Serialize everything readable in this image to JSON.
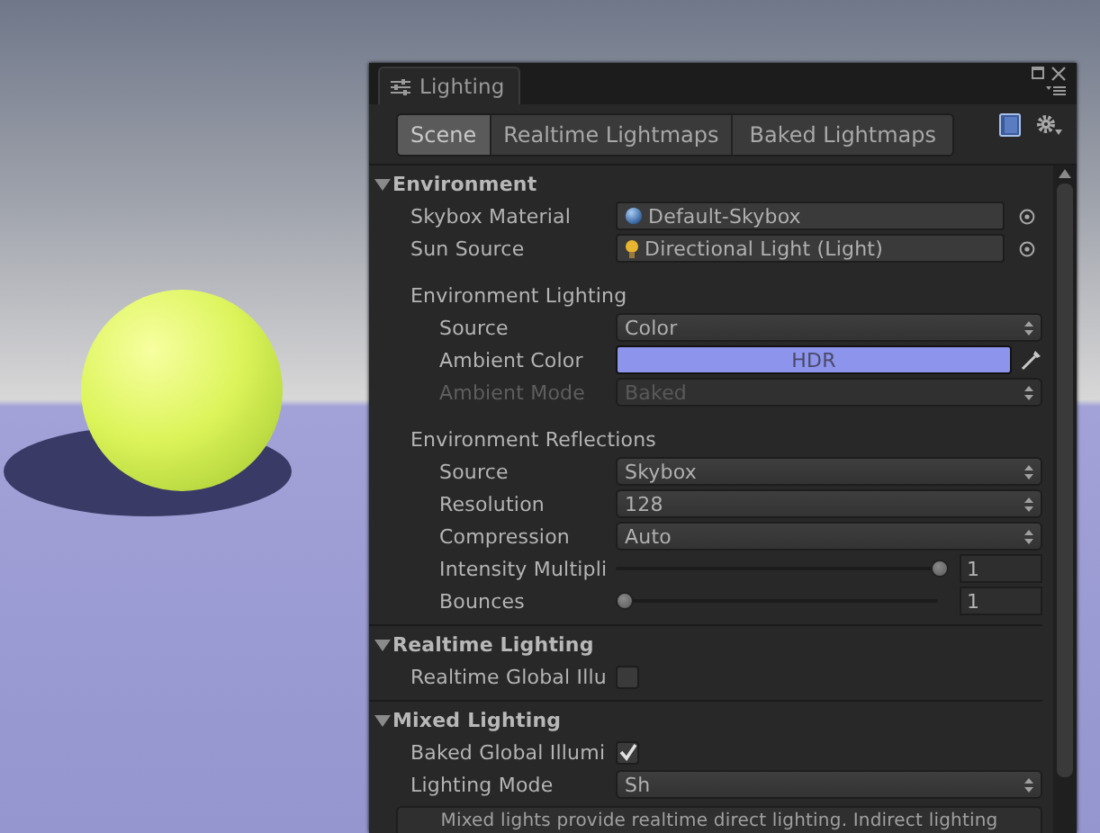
{
  "window": {
    "title": "Lighting"
  },
  "tabs": [
    {
      "label": "Scene",
      "selected": true
    },
    {
      "label": "Realtime Lightmaps",
      "selected": false
    },
    {
      "label": "Baked Lightmaps",
      "selected": false
    }
  ],
  "sections": [
    {
      "title": "Environment",
      "expanded": true,
      "rows": [
        {
          "kind": "material",
          "label": "Skybox Material",
          "value": "Default-Skybox",
          "disabled": false
        },
        {
          "kind": "light",
          "label": "Sun Source",
          "value": "Directional Light (Light)",
          "disabled": false
        },
        {
          "kind": "group",
          "title": "Environment Lighting",
          "rows": [
            {
              "kind": "dropdown",
              "label": "Source",
              "value": "Color",
              "disabled": false
            },
            {
              "kind": "color",
              "label": "Ambient Color",
              "value": "HDR",
              "color": "#8c94ec",
              "disabled": false
            },
            {
              "kind": "dropdown",
              "label": "Ambient Mode",
              "value": "Baked",
              "disabled": true
            }
          ]
        },
        {
          "kind": "group",
          "title": "Environment Reflections",
          "rows": [
            {
              "kind": "dropdown",
              "label": "Source",
              "value": "Skybox",
              "disabled": false
            },
            {
              "kind": "dropdown",
              "label": "Resolution",
              "value": "128",
              "disabled": false
            },
            {
              "kind": "dropdown",
              "label": "Compression",
              "value": "Auto",
              "disabled": false
            },
            {
              "kind": "slider",
              "label": "Intensity Multipli",
              "level": 1,
              "reading": "1",
              "disabled": false
            },
            {
              "kind": "slider",
              "label": "Bounces",
              "level": 0,
              "reading": "1",
              "disabled": false
            }
          ]
        }
      ]
    },
    {
      "title": "Realtime Lighting",
      "expanded": true,
      "rows": [
        {
          "kind": "checkbox",
          "label": "Realtime Global Illu",
          "checked": false,
          "disabled": false
        }
      ]
    },
    {
      "title": "Mixed Lighting",
      "expanded": true,
      "rows": [
        {
          "kind": "checkbox",
          "label": "Baked Global Illumi",
          "checked": true,
          "disabled": false
        },
        {
          "kind": "dropdown",
          "label": "Lighting Mode",
          "value": "Sh",
          "disabled": false
        },
        {
          "kind": "help",
          "text": "Mixed lights provide realtime direct lighting. Indirect lighting"
        }
      ]
    }
  ]
}
